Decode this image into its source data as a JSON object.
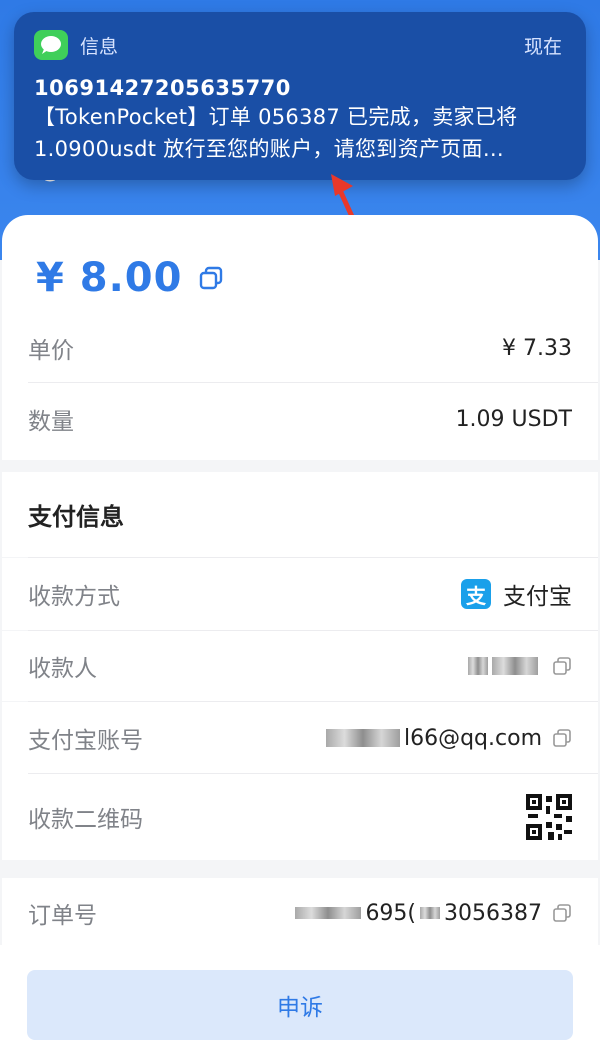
{
  "notification": {
    "app_name": "信息",
    "time": "现在",
    "sender": "10691427205635770",
    "body_line1": "【TokenPocket】订单 056387 已完成，卖家已将",
    "body_line2": "1.0900usdt 放行至您的账户，请您到资产页面…"
  },
  "order": {
    "amount": "¥ 8.00",
    "unit_price_label": "单价",
    "unit_price": "¥ 7.33",
    "quantity_label": "数量",
    "quantity": "1.09 USDT"
  },
  "payment": {
    "section_title": "支付信息",
    "method_label": "收款方式",
    "method_value": "支付宝",
    "payee_label": "收款人",
    "account_label": "支付宝账号",
    "account_value": "l66@qq.com",
    "qr_label": "收款二维码"
  },
  "order_no": {
    "label": "订单号",
    "value_part1": "695(",
    "value_part2": "3056387"
  },
  "actions": {
    "appeal_label": "申诉"
  },
  "colors": {
    "accent": "#2f7ae6",
    "notification_bg": "#1a4fa6",
    "alipay": "#1aa0ea"
  }
}
